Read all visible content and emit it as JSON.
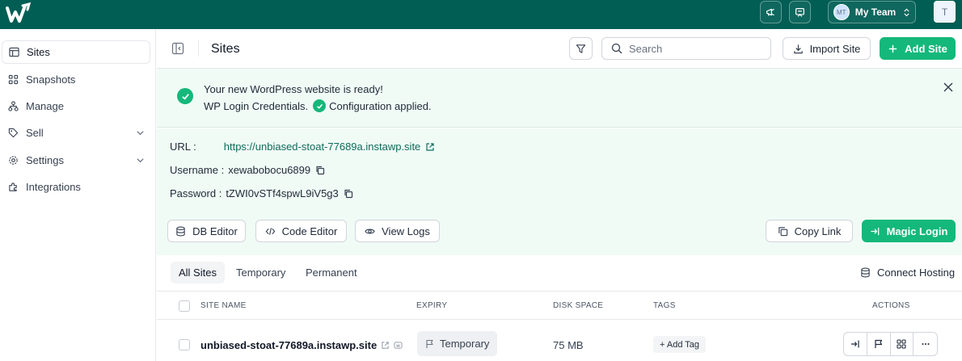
{
  "topbar": {
    "brand_icon": "logo-mark",
    "team_initials": "MT",
    "team_label": "My Team",
    "user_initial": "T",
    "bg_color": "#005e54"
  },
  "sidebar": {
    "items": [
      {
        "label": "Sites",
        "icon": "window-icon",
        "active": true
      },
      {
        "label": "Snapshots",
        "icon": "grid-icon"
      },
      {
        "label": "Manage",
        "icon": "sitemap-icon"
      },
      {
        "label": "Sell",
        "icon": "tag-icon",
        "has_chevron": true
      },
      {
        "label": "Settings",
        "icon": "gear-icon",
        "has_chevron": true
      },
      {
        "label": "Integrations",
        "icon": "puzzle-icon"
      }
    ]
  },
  "header": {
    "title": "Sites",
    "search_placeholder": "Search",
    "import_label": "Import Site",
    "add_label": "Add Site"
  },
  "notice": {
    "line1": "Your new WordPress website is ready!",
    "credentials_label": "WP Login Credentials.",
    "config_label": "Configuration applied."
  },
  "credentials": {
    "url_label": "URL :",
    "url_value": "https://unbiased-stoat-77689a.instawp.site",
    "username_label": "Username :",
    "username_value": "xewabobocu6899",
    "password_label": "Password :",
    "password_value": "tZWI0vSTf4spwL9iV5g3"
  },
  "tools": {
    "db_editor": "DB Editor",
    "code_editor": "Code Editor",
    "view_logs": "View Logs",
    "copy_link": "Copy Link",
    "magic_login": "Magic Login"
  },
  "tabs": {
    "all": "All Sites",
    "temporary": "Temporary",
    "permanent": "Permanent",
    "connect_hosting": "Connect Hosting"
  },
  "table": {
    "columns": {
      "site_name": "SITE NAME",
      "expiry": "EXPIRY",
      "disk_space": "DISK SPACE",
      "tags": "TAGS",
      "actions": "ACTIONS"
    },
    "rows": [
      {
        "site_name": "unbiased-stoat-77689a.instawp.site",
        "expiry": "Temporary",
        "disk_space": "75 MB",
        "add_tag": "+ Add Tag"
      }
    ]
  },
  "colors": {
    "accent": "#14b87a",
    "notice_bg": "#f0fbf6",
    "link": "#0f6b5a"
  }
}
